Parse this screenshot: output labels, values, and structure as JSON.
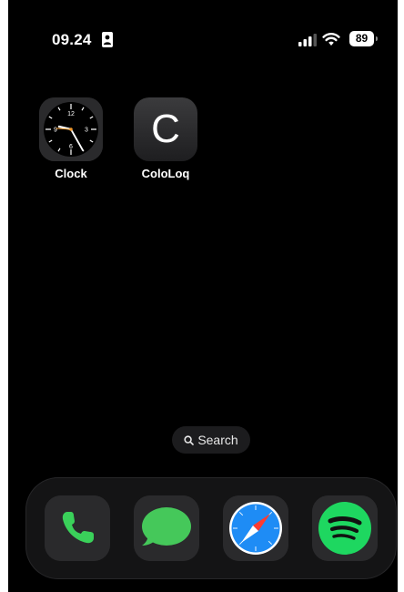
{
  "status_bar": {
    "time": "09.24",
    "battery": "89"
  },
  "home_apps": [
    {
      "label": "Clock",
      "icon": "clock-icon"
    },
    {
      "label": "ColoLoq",
      "icon": "cololoq-icon",
      "glyph": "C"
    }
  ],
  "search": {
    "label": "Search"
  },
  "dock": [
    {
      "icon": "phone-icon",
      "color": "#3ad15a"
    },
    {
      "icon": "messages-icon",
      "color": "#45c85a"
    },
    {
      "icon": "safari-icon",
      "color": "#1e8cf5"
    },
    {
      "icon": "spotify-icon",
      "color": "#1ed760"
    }
  ]
}
